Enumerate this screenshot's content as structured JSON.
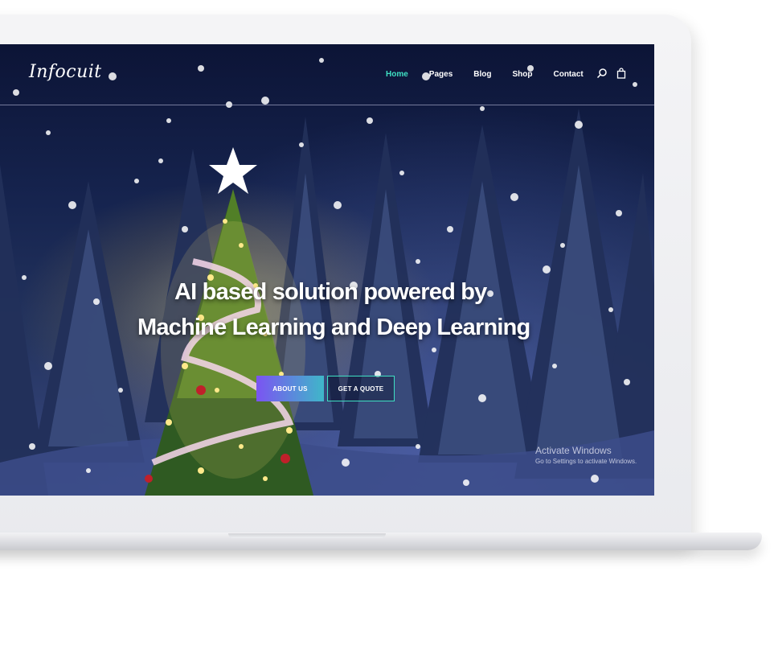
{
  "header": {
    "logo": "Infocuit",
    "nav": [
      "Home",
      "Pages",
      "Blog",
      "Shop",
      "Contact"
    ],
    "active_nav": "Home",
    "icons": [
      "search-icon",
      "cart-icon"
    ]
  },
  "hero": {
    "line1": "AI based solution powered by",
    "line2": "Machine Learning and Deep Learning",
    "buttons": {
      "about": "ABOUT US",
      "quote": "GET A QUOTE"
    }
  },
  "watermark": {
    "title": "Activate Windows",
    "subtitle": "Go to Settings to activate Windows."
  },
  "colors": {
    "accent": "#3fe0c3",
    "button_gradient_start": "#7b54f2",
    "button_gradient_end": "#3fb7c9"
  }
}
